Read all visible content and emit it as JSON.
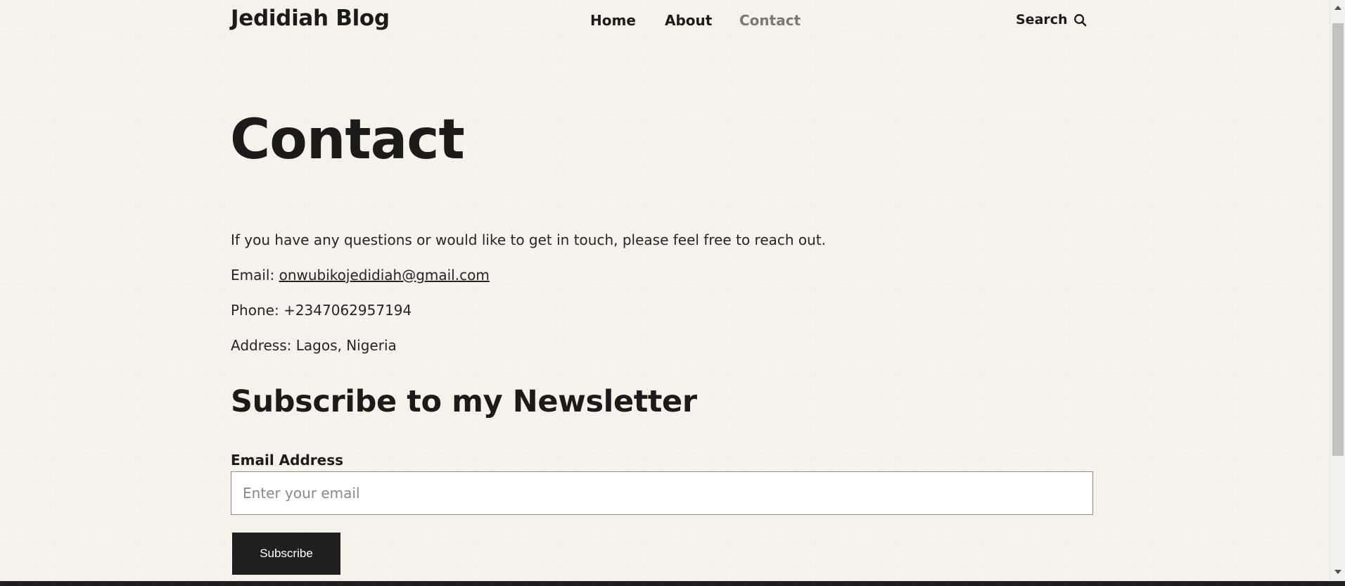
{
  "header": {
    "site_title": "Jedidiah Blog",
    "nav": [
      "Home",
      "About",
      "Contact"
    ],
    "active_nav": "Contact",
    "search_label": "Search"
  },
  "main": {
    "title": "Contact",
    "intro": "If you have any questions or would like to get in touch, please feel free to reach out.",
    "email_label": "Email:",
    "email_value": "onwubikojedidiah@gmail.com",
    "phone_label": "Phone:",
    "phone_value": "+2347062957194",
    "address_label": "Address:",
    "address_value": "Lagos, Nigeria"
  },
  "newsletter": {
    "heading": "Subscribe to my Newsletter",
    "field_label": "Email Address",
    "placeholder": "Enter your email",
    "button_label": "Subscribe"
  },
  "colors": {
    "background": "#f6f2ec",
    "text": "#1c1b1a",
    "nav_active": "#7b7874",
    "button": "#1f1f1f"
  },
  "icons": {
    "search": "search-icon"
  }
}
